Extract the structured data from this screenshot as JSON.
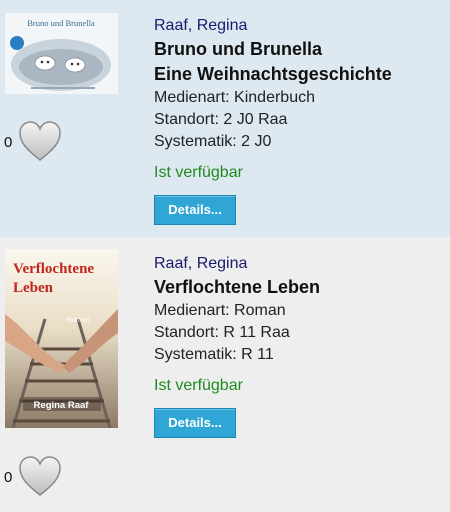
{
  "results": [
    {
      "author": "Raaf, Regina",
      "title_line1": "Bruno und Brunella",
      "title_line2": "Eine Weihnachtsgeschichte",
      "medienart": "Medienart: Kinderbuch",
      "standort": "Standort: 2 J0 Raa",
      "systematik": "Systematik: 2 J0",
      "availability": "Ist verfügbar",
      "details_label": "Details...",
      "likes": "0",
      "cover_text": "Bruno und Brunella"
    },
    {
      "author": "Raaf, Regina",
      "title_line1": "Verflochtene Leben",
      "medienart": "Medienart: Roman",
      "standort": "Standort: R 11 Raa",
      "systematik": "Systematik: R 11",
      "availability": "Ist verfügbar",
      "details_label": "Details...",
      "likes": "0",
      "cover_title1": "Verflochtene",
      "cover_title2": "Leben",
      "cover_genre": "Roman",
      "cover_author": "Regina Raaf"
    }
  ],
  "colors": {
    "author": "#1a1a6e",
    "available": "#1f8a1f",
    "button": "#2fa6d6",
    "row1_bg": "#dde8f0",
    "row2_bg": "#eeeeee"
  }
}
